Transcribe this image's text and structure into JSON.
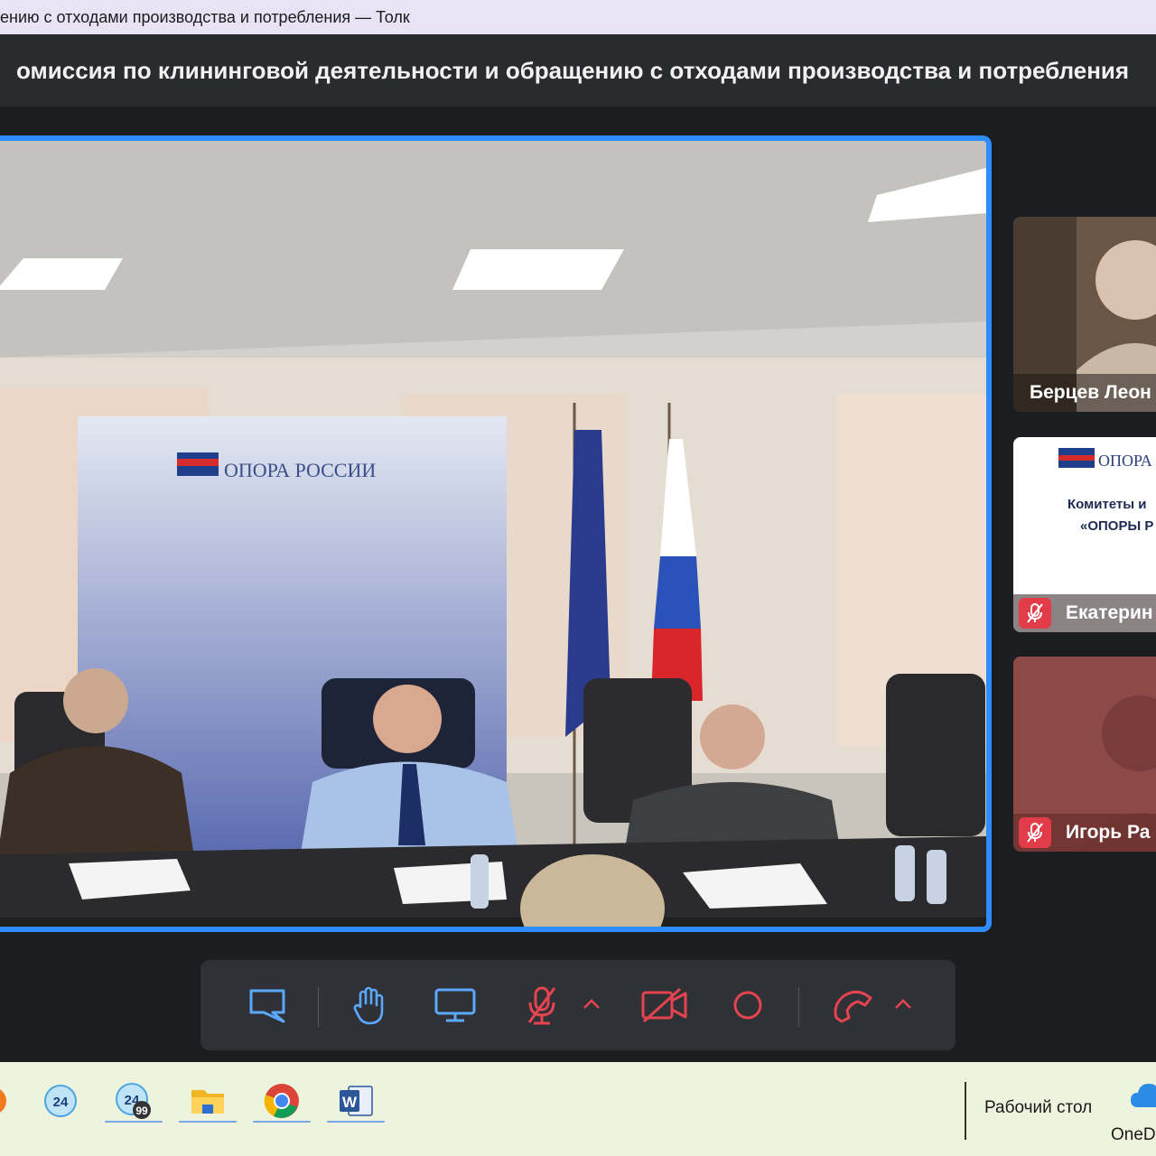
{
  "window": {
    "title": "ению с отходами производства и потребления — Толк"
  },
  "meeting": {
    "title": "омиссия по клининговой деятельности и обращению с отходами производства и потребления"
  },
  "main_video": {
    "banner_text": "ОПОРА РОССИИ"
  },
  "participants": [
    {
      "name": "Берцев Леон",
      "muted": false
    },
    {
      "name": "Екатерин",
      "muted": true,
      "slide_brand": "ОПОРА",
      "slide_line1": "Комитеты и",
      "slide_line2": "«ОПОРЫ Р"
    },
    {
      "name": "Игорь Ра",
      "muted": true
    }
  ],
  "toolbar": {
    "buttons": [
      {
        "name": "chat",
        "icon": "chat-icon"
      },
      {
        "name": "raise-hand",
        "icon": "hand-icon"
      },
      {
        "name": "screen-share",
        "icon": "monitor-icon"
      },
      {
        "name": "microphone",
        "icon": "mic-off-icon",
        "state": "off"
      },
      {
        "name": "camera",
        "icon": "camera-off-icon",
        "state": "off"
      },
      {
        "name": "record",
        "icon": "record-icon"
      },
      {
        "name": "hang-up",
        "icon": "phone-icon"
      }
    ],
    "accent_color": "#e3444f"
  },
  "taskbar": {
    "apps": [
      {
        "name": "app-partial",
        "icon": "orange-icon"
      },
      {
        "name": "app-24",
        "badge": "24"
      },
      {
        "name": "app-24-99",
        "badge": "24",
        "counter": "99"
      },
      {
        "name": "file-explorer",
        "icon": "folder-icon"
      },
      {
        "name": "chrome",
        "icon": "chrome-icon"
      },
      {
        "name": "word",
        "icon": "word-icon",
        "letter": "W"
      }
    ],
    "desktop_label": "Рабочий стол",
    "onedrive_label": "OneD"
  }
}
